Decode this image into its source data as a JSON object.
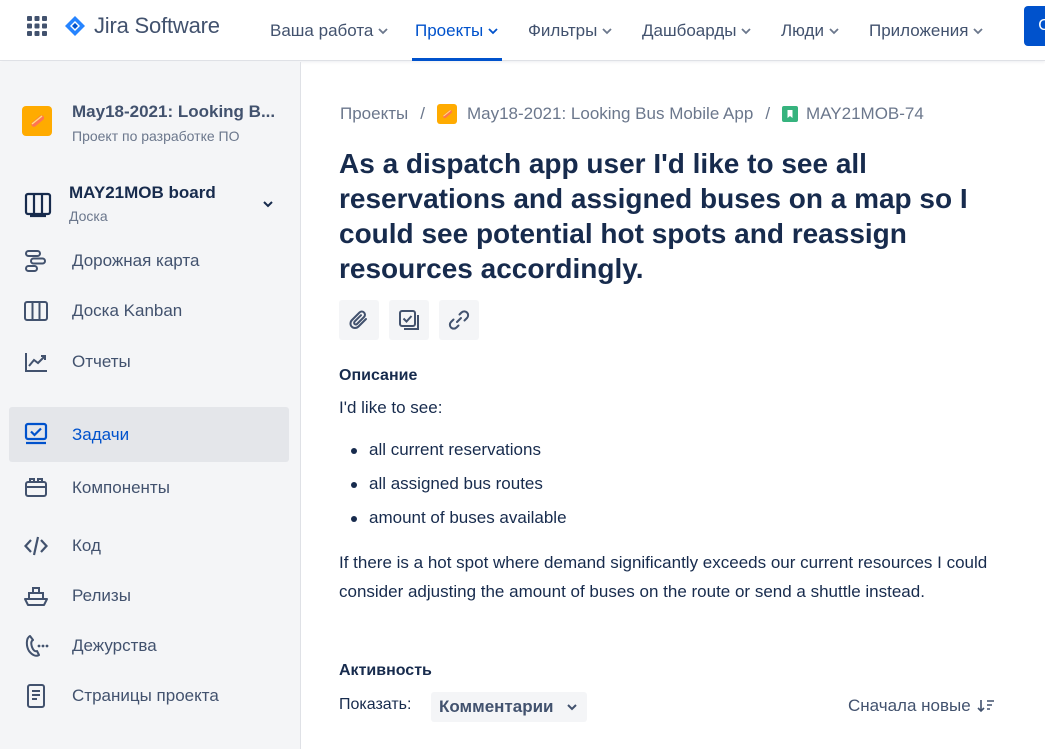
{
  "topnav": {
    "product_name": "Jira Software",
    "items": [
      {
        "label": "Ваша работа"
      },
      {
        "label": "Проекты"
      },
      {
        "label": "Фильтры"
      },
      {
        "label": "Дашбоарды"
      },
      {
        "label": "Люди"
      },
      {
        "label": "Приложения"
      }
    ],
    "active_item": "Проекты",
    "create_label": "С"
  },
  "sidebar": {
    "project": {
      "name": "May18-2021: Looking B...",
      "type": "Проект по разработке ПО"
    },
    "board": {
      "name": "MAY21MOB board",
      "subtitle": "Доска"
    },
    "items": [
      {
        "label": "Дорожная карта",
        "icon": "roadmap-icon"
      },
      {
        "label": "Доска Kanban",
        "icon": "board-columns-icon"
      },
      {
        "label": "Отчеты",
        "icon": "chart-line-icon"
      },
      {
        "label": "Задачи",
        "icon": "issues-icon"
      },
      {
        "label": "Компоненты",
        "icon": "component-icon"
      },
      {
        "label": "Код",
        "icon": "code-icon"
      },
      {
        "label": "Релизы",
        "icon": "ship-icon"
      },
      {
        "label": "Дежурства",
        "icon": "phone-icon"
      },
      {
        "label": "Страницы проекта",
        "icon": "page-icon"
      }
    ],
    "active_item": "Задачи"
  },
  "breadcrumbs": {
    "root": "Проекты",
    "project": "May18-2021: Looking Bus Mobile App",
    "issue_key": "MAY21MOB-74"
  },
  "issue": {
    "title": "As a dispatch app user I'd like to see all reservations and assigned buses on a map so I could see potential hot spots and reassign resources accordingly.",
    "description_heading": "Описание",
    "description_intro": "I'd like to see:",
    "description_bullets": [
      "all current reservations",
      "all assigned bus routes",
      "amount of buses available"
    ],
    "description_paragraph": "If there is a hot spot where demand significantly exceeds our current resources I could consider adjusting the amount of buses on the route or send a shuttle instead."
  },
  "activity": {
    "heading": "Активность",
    "show_label": "Показать:",
    "filter_value": "Комментарии",
    "sort_label": "Сначала новые"
  },
  "colors": {
    "brand": "#0052cc",
    "project_avatar": "#ffab00",
    "story": "#36b37e"
  }
}
